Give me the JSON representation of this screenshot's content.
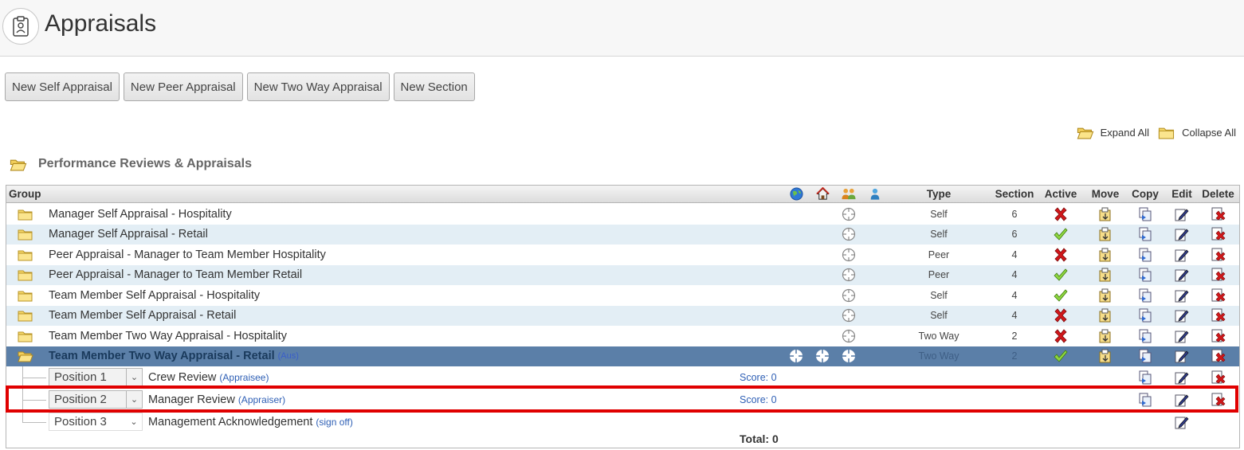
{
  "header": {
    "title": "Appraisals"
  },
  "toolbar": {
    "new_self": "New Self Appraisal",
    "new_peer": "New Peer Appraisal",
    "new_two_way": "New Two Way Appraisal",
    "new_section": "New Section"
  },
  "expand": {
    "expand_all": "Expand All",
    "collapse_all": "Collapse All"
  },
  "section": {
    "title": "Performance Reviews & Appraisals"
  },
  "grid": {
    "headers": {
      "group": "Group",
      "type": "Type",
      "section": "Section",
      "active": "Active",
      "move": "Move",
      "copy": "Copy",
      "edit": "Edit",
      "delete": "Delete"
    },
    "rows": [
      {
        "name": "Manager Self Appraisal - Hospitality",
        "type": "Self",
        "section": "6",
        "active": false
      },
      {
        "name": "Manager Self Appraisal - Retail",
        "type": "Self",
        "section": "6",
        "active": true
      },
      {
        "name": "Peer Appraisal - Manager to Team Member Hospitality",
        "type": "Peer",
        "section": "4",
        "active": false
      },
      {
        "name": "Peer Appraisal - Manager to Team Member Retail",
        "type": "Peer",
        "section": "4",
        "active": true
      },
      {
        "name": "Team Member Self Appraisal - Hospitality",
        "type": "Self",
        "section": "4",
        "active": true
      },
      {
        "name": "Team Member Self Appraisal - Retail",
        "type": "Self",
        "section": "4",
        "active": false
      },
      {
        "name": "Team Member Two Way Appraisal - Hospitality",
        "type": "Two Way",
        "section": "2",
        "active": false
      },
      {
        "name": "Team Member Two Way Appraisal - Retail",
        "tag": "(Aus)",
        "type": "Two Way",
        "section": "2",
        "active": true
      }
    ],
    "subrows": [
      {
        "position": "Position 1",
        "name": "Crew Review",
        "role": "(Appraisee)",
        "score": "Score: 0"
      },
      {
        "position": "Position 2",
        "name": "Manager Review",
        "role": "(Appraiser)",
        "score": "Score: 0"
      },
      {
        "position": "Position 3",
        "name": "Management Acknowledgement",
        "role": "(sign off)"
      }
    ],
    "total": "Total: 0"
  },
  "colors": {
    "selected_row": "#5b7fa8",
    "alt_row": "#e3eef5",
    "highlight": "#e00000",
    "link": "#2e5fb5"
  }
}
